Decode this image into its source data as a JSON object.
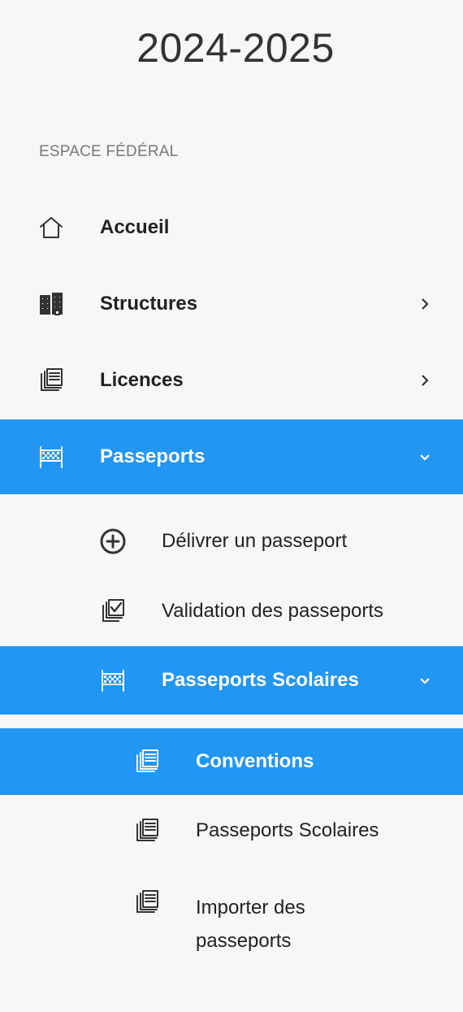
{
  "sidebar": {
    "season": "2024-2025",
    "section_label": "ESPACE FÉDÉRAL",
    "accent_color": "#2196f3",
    "items": [
      {
        "label": "Accueil",
        "icon": "home-icon"
      },
      {
        "label": "Structures",
        "icon": "buildings-icon"
      },
      {
        "label": "Licences",
        "icon": "documents-icon"
      },
      {
        "label": "Passeports",
        "icon": "checkered-flag-icon"
      }
    ],
    "passeports_sub": [
      {
        "label": "Délivrer un passeport",
        "icon": "plus-circle-icon"
      },
      {
        "label": "Validation des passeports",
        "icon": "check-documents-icon"
      },
      {
        "label": "Passeports Scolaires",
        "icon": "checkered-flag-icon"
      }
    ],
    "scolaires_sub": [
      {
        "label": "Conventions",
        "icon": "documents-icon"
      },
      {
        "label": "Passeports Scolaires",
        "icon": "documents-icon"
      },
      {
        "label_line1": "Importer des",
        "label_line2": "passeports",
        "icon": "documents-icon"
      }
    ]
  }
}
